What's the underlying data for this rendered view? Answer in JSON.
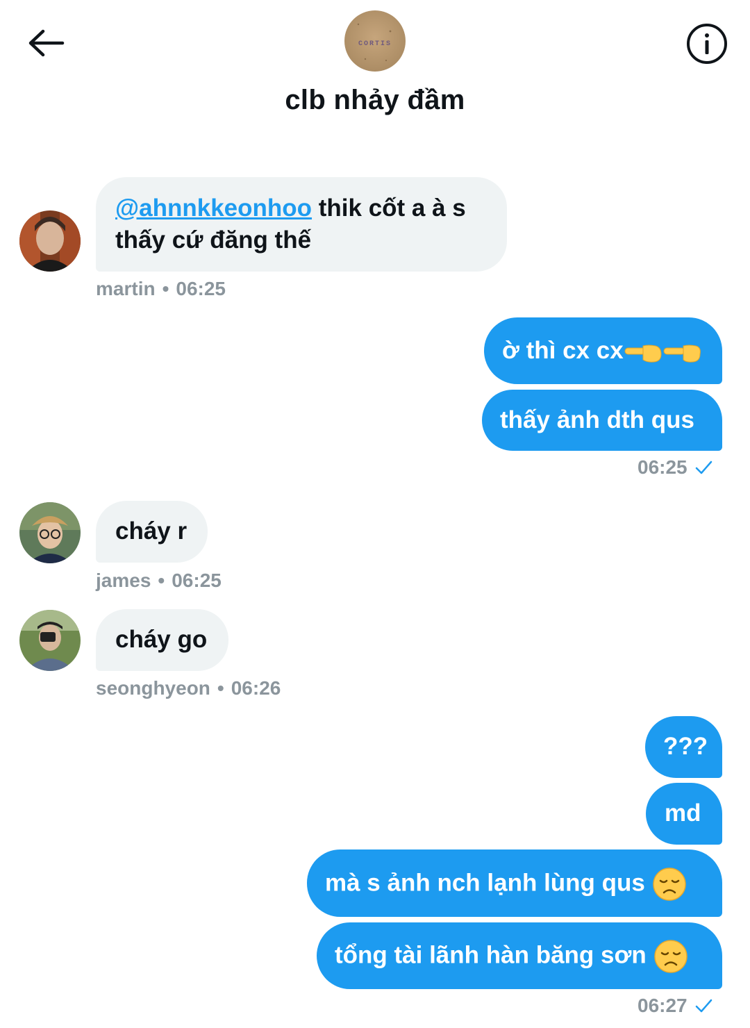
{
  "header": {
    "title": "clb nhảy đầm",
    "avatar_text": "CORTIS",
    "back_icon": "arrow-left-icon",
    "info_icon": "info-icon"
  },
  "messages": [
    {
      "sender": "martin",
      "mention": "@ahnnkkeonhoo",
      "text_line1": " thik cốt a à s",
      "text_line2": "thấy cứ đăng thế",
      "time": "06:25",
      "dot": "•"
    },
    {
      "outgoing": [
        "ờ thì cx cx",
        "thấy ảnh dth qus"
      ],
      "time": "06:25"
    },
    {
      "sender": "james",
      "text": "cháy r",
      "time": "06:25",
      "dot": "•"
    },
    {
      "sender": "seonghyeon",
      "text": "cháy go",
      "time": "06:26",
      "dot": "•"
    },
    {
      "outgoing": [
        "???",
        "md",
        "mà s ảnh nch lạnh lùng qus",
        "tổng tài lãnh hàn băng sơn"
      ],
      "time": "06:27"
    }
  ],
  "colors": {
    "accent": "#1d9bf0",
    "incoming_bubble": "#eff3f4",
    "meta_text": "#8b959c"
  },
  "emoji": {
    "pointing": "pointing-hand-emoji",
    "sad": "disappointed-face-emoji"
  }
}
